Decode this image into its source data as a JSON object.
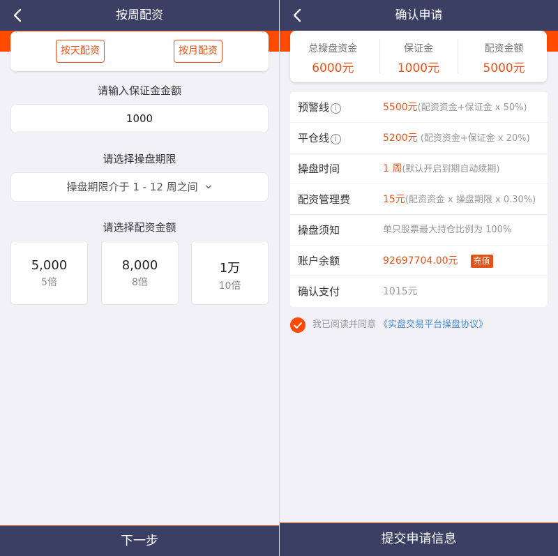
{
  "left": {
    "header": {
      "title": "按周配资"
    },
    "modes": {
      "day_label": "按天配资",
      "month_label": "按月配资"
    },
    "deposit": {
      "label": "请输入保证金金额",
      "value": "1000"
    },
    "period": {
      "label": "请选择操盘期限",
      "selected": "操盘期限介于 1 - 12 周之间"
    },
    "amount": {
      "label": "请选择配资金额",
      "options": [
        {
          "amount": "5,000",
          "multiple": "5倍"
        },
        {
          "amount": "8,000",
          "multiple": "8倍"
        },
        {
          "amount": "1万",
          "multiple": "10倍"
        }
      ]
    },
    "next_label": "下一步"
  },
  "right": {
    "header": {
      "title": "确认申请"
    },
    "summary": [
      {
        "label": "总操盘资金",
        "value": "6000元"
      },
      {
        "label": "保证金",
        "value": "1000元"
      },
      {
        "label": "配资金额",
        "value": "5000元"
      }
    ],
    "rows": {
      "warning": {
        "key": "预警线",
        "value": "5500元",
        "note": "(配资资金+保证金 x 50%)"
      },
      "liquidation": {
        "key": "平仓线",
        "value": "5200元",
        "note": " (配资资金+保证金 x 20%)"
      },
      "time": {
        "key": "操盘时间",
        "value": "1 周",
        "note": "(默认开启到期自动续期)"
      },
      "fee": {
        "key": "配资管理费",
        "value": "15元",
        "note": "(配资资金 x 操盘期限 x 0.30%)"
      },
      "notice": {
        "key": "操盘须知",
        "note": "单只股票最大持仓比例为 100%"
      },
      "balance": {
        "key": "账户余额",
        "value": "92697704.00元",
        "recharge": "充值"
      },
      "pay": {
        "key": "确认支付",
        "note": "1015元"
      }
    },
    "agreement": {
      "text": "我已阅读并同意",
      "link": "《实盘交易平台操盘协议》"
    },
    "submit_label": "提交申请信息"
  },
  "colors": {
    "navy": "#3b3f63",
    "orange": "#ff4a00",
    "accent": "#e2541b",
    "link": "#4a8fd4"
  },
  "icons": [
    "back-arrow-icon",
    "chevron-down-icon",
    "info-icon",
    "check-icon"
  ]
}
